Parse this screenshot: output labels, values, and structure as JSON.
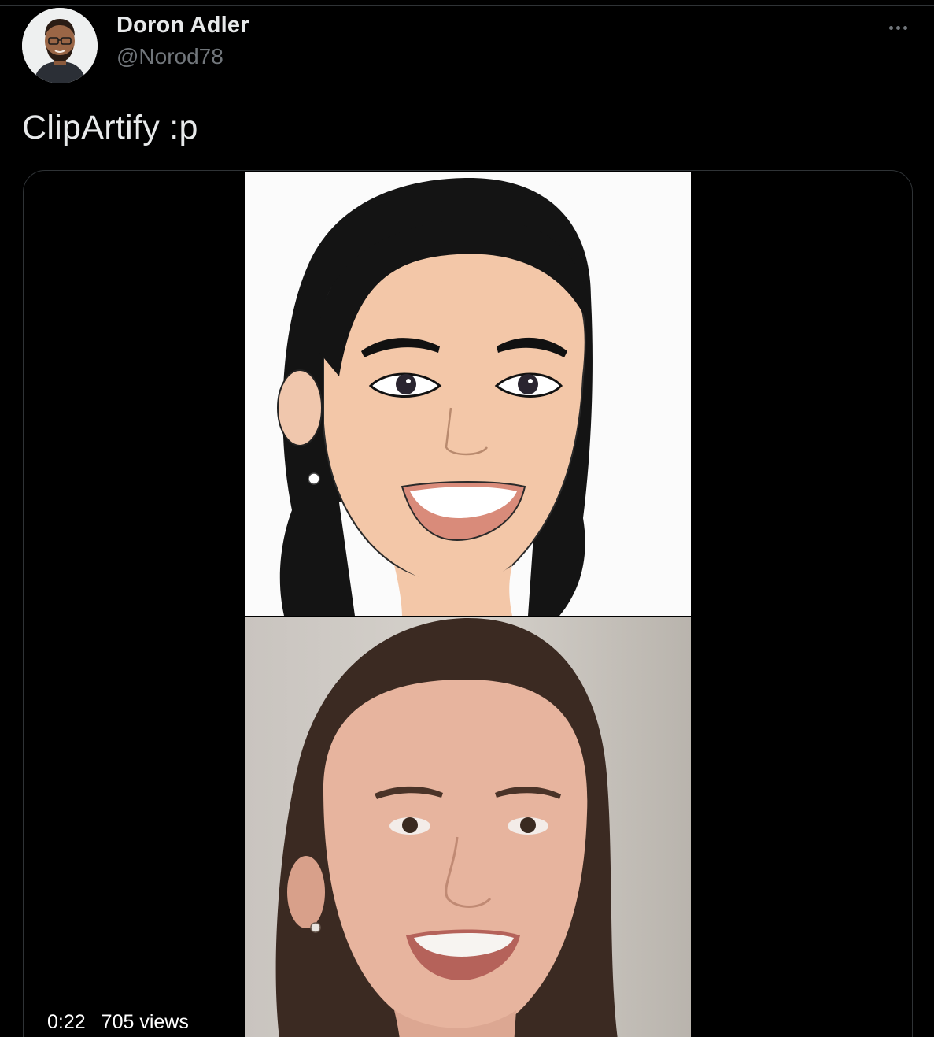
{
  "tweet": {
    "author": {
      "display_name": "Doron Adler",
      "handle": "@Norod78",
      "avatar_icon": "profile-photo"
    },
    "more_icon": "ellipsis-icon",
    "text": "ClipArtify :p",
    "media": {
      "type": "video",
      "duration": "0:22",
      "views": "705 views"
    }
  },
  "colors": {
    "background": "#000000",
    "text_primary": "#e7e9ea",
    "text_secondary": "#71767b",
    "border": "#2f3336"
  }
}
